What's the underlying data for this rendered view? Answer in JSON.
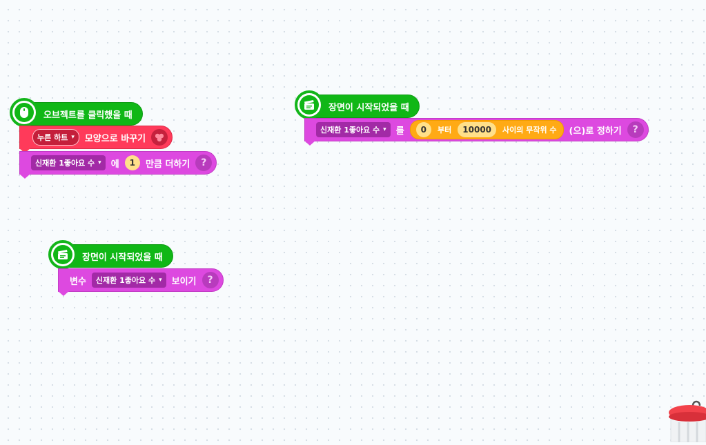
{
  "scripts": [
    {
      "hat": {
        "icon": "mouse-icon",
        "label": "오브젝트를 클릭했을 때"
      },
      "change_shape": {
        "dropdown": "누른 하트",
        "label": "모양으로 바꾸기",
        "icon": "shape-icon"
      },
      "add_var": {
        "variable": "신재환 1좋아요 수",
        "label1": "에",
        "value": "1",
        "label2": "만큼 더하기",
        "help": "?"
      }
    },
    {
      "hat": {
        "icon": "clapperboard-icon",
        "label": "장면이 시작되었을 때"
      },
      "set_var": {
        "variable": "신재환 1좋아요 수",
        "label1": "를",
        "from": "0",
        "from_label": "부터",
        "to": "10000",
        "to_label": "사이의 무작위 수",
        "label2": "(으)로 정하기",
        "help": "?"
      }
    },
    {
      "hat": {
        "icon": "clapperboard-icon",
        "label": "장면이 시작되었을 때"
      },
      "show_var": {
        "label1": "변수",
        "variable": "신재환 1좋아요 수",
        "label2": "보이기",
        "help": "?"
      }
    }
  ],
  "dropdown_arrow": "▾",
  "colors": {
    "start_green": "#10b716",
    "looks_red": "#ff3a5a",
    "variable_purple": "#dd49e0",
    "calc_orange": "#ffaa15",
    "trash_red": "#f2424b"
  }
}
